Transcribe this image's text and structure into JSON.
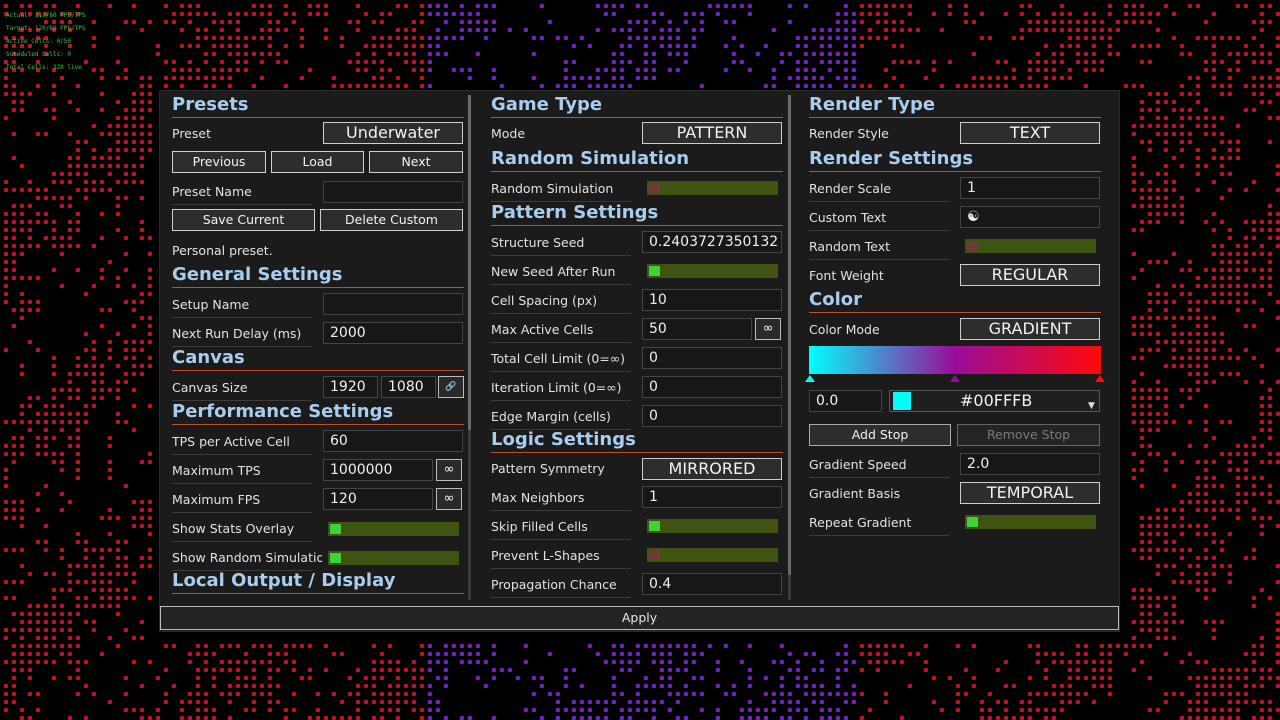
{
  "stats": [
    "Actual: 119/60 FPS/TPS",
    "Target: 120/60 FPS/TPS",
    "Active Cells: 0/50",
    "Scheduled Cells: 0",
    "Total Cells: 328 live"
  ],
  "col1": {
    "presets_header": "Presets",
    "preset_label": "Preset",
    "preset_value": "Underwater",
    "previous": "Previous",
    "load": "Load",
    "next": "Next",
    "preset_name_label": "Preset Name",
    "preset_name_value": "",
    "save_current": "Save Current",
    "delete_custom": "Delete Custom",
    "personal_note": "Personal preset.",
    "general_header": "General Settings",
    "setup_name_label": "Setup Name",
    "setup_name_value": "",
    "next_run_label": "Next Run Delay (ms)",
    "next_run_value": "2000",
    "canvas_header": "Canvas",
    "canvas_size_label": "Canvas Size",
    "canvas_w": "1920",
    "canvas_h": "1080",
    "perf_header": "Performance Settings",
    "tps_label": "TPS per Active Cell",
    "tps_value": "60",
    "max_tps_label": "Maximum TPS",
    "max_tps_value": "1000000",
    "max_fps_label": "Maximum FPS",
    "max_fps_value": "120",
    "show_stats_label": "Show Stats Overlay",
    "show_random_label": "Show Random Simulation Stats",
    "local_output_header": "Local Output / Display"
  },
  "col2": {
    "game_type_header": "Game Type",
    "mode_label": "Mode",
    "mode_value": "PATTERN",
    "random_sim_header": "Random Simulation",
    "random_sim_label": "Random Simulation",
    "pattern_header": "Pattern Settings",
    "structure_seed_label": "Structure Seed",
    "structure_seed_value": "0.2403727350132",
    "new_seed_label": "New Seed After Run",
    "cell_spacing_label": "Cell Spacing (px)",
    "cell_spacing_value": "10",
    "max_active_label": "Max Active Cells",
    "max_active_value": "50",
    "total_limit_label": "Total Cell Limit (0=∞)",
    "total_limit_value": "0",
    "iteration_label": "Iteration Limit (0=∞)",
    "iteration_value": "0",
    "edge_margin_label": "Edge Margin (cells)",
    "edge_margin_value": "0",
    "logic_header": "Logic Settings",
    "symmetry_label": "Pattern Symmetry",
    "symmetry_value": "MIRRORED",
    "max_neighbors_label": "Max Neighbors",
    "max_neighbors_value": "1",
    "skip_filled_label": "Skip Filled Cells",
    "prevent_l_label": "Prevent L-Shapes",
    "propagation_label": "Propagation Chance",
    "propagation_value": "0.4"
  },
  "col3": {
    "render_type_header": "Render Type",
    "render_style_label": "Render Style",
    "render_style_value": "TEXT",
    "render_settings_header": "Render Settings",
    "render_scale_label": "Render Scale",
    "render_scale_value": "1",
    "custom_text_label": "Custom Text",
    "custom_text_value": "☯",
    "random_text_label": "Random Text",
    "font_weight_label": "Font Weight",
    "font_weight_value": "REGULAR",
    "color_header": "Color",
    "color_mode_label": "Color Mode",
    "color_mode_value": "GRADIENT",
    "stop_position_value": "0.0",
    "stop_color_value": "#00FFFB",
    "add_stop": "Add Stop",
    "remove_stop": "Remove Stop",
    "gradient_speed_label": "Gradient Speed",
    "gradient_speed_value": "2.0",
    "gradient_basis_label": "Gradient Basis",
    "gradient_basis_value": "TEMPORAL",
    "repeat_gradient_label": "Repeat Gradient"
  },
  "toggles": {
    "show_stats": true,
    "show_random_stats": true,
    "random_simulation": false,
    "new_seed_after_run": true,
    "skip_filled_cells": true,
    "prevent_l_shapes": false,
    "random_text": false,
    "repeat_gradient": true
  },
  "gradient_stops": [
    {
      "position": 0.0,
      "color": "#00FFFB"
    },
    {
      "position": 0.5,
      "color": "#9B0B99"
    },
    {
      "position": 1.0,
      "color": "#FF0A0A"
    }
  ],
  "apply": "Apply",
  "icons": {
    "infinity": "∞",
    "link": "🔗"
  },
  "colors": {
    "header": "#A9CDEE",
    "header_underline": "#C0502B",
    "toggle_track": "#3E5410",
    "toggle_on": "#3ED13E",
    "toggle_off": "#6E3A3A",
    "background_pattern_red": "#E0192A",
    "background_pattern_purple": "#8A2BE2"
  }
}
